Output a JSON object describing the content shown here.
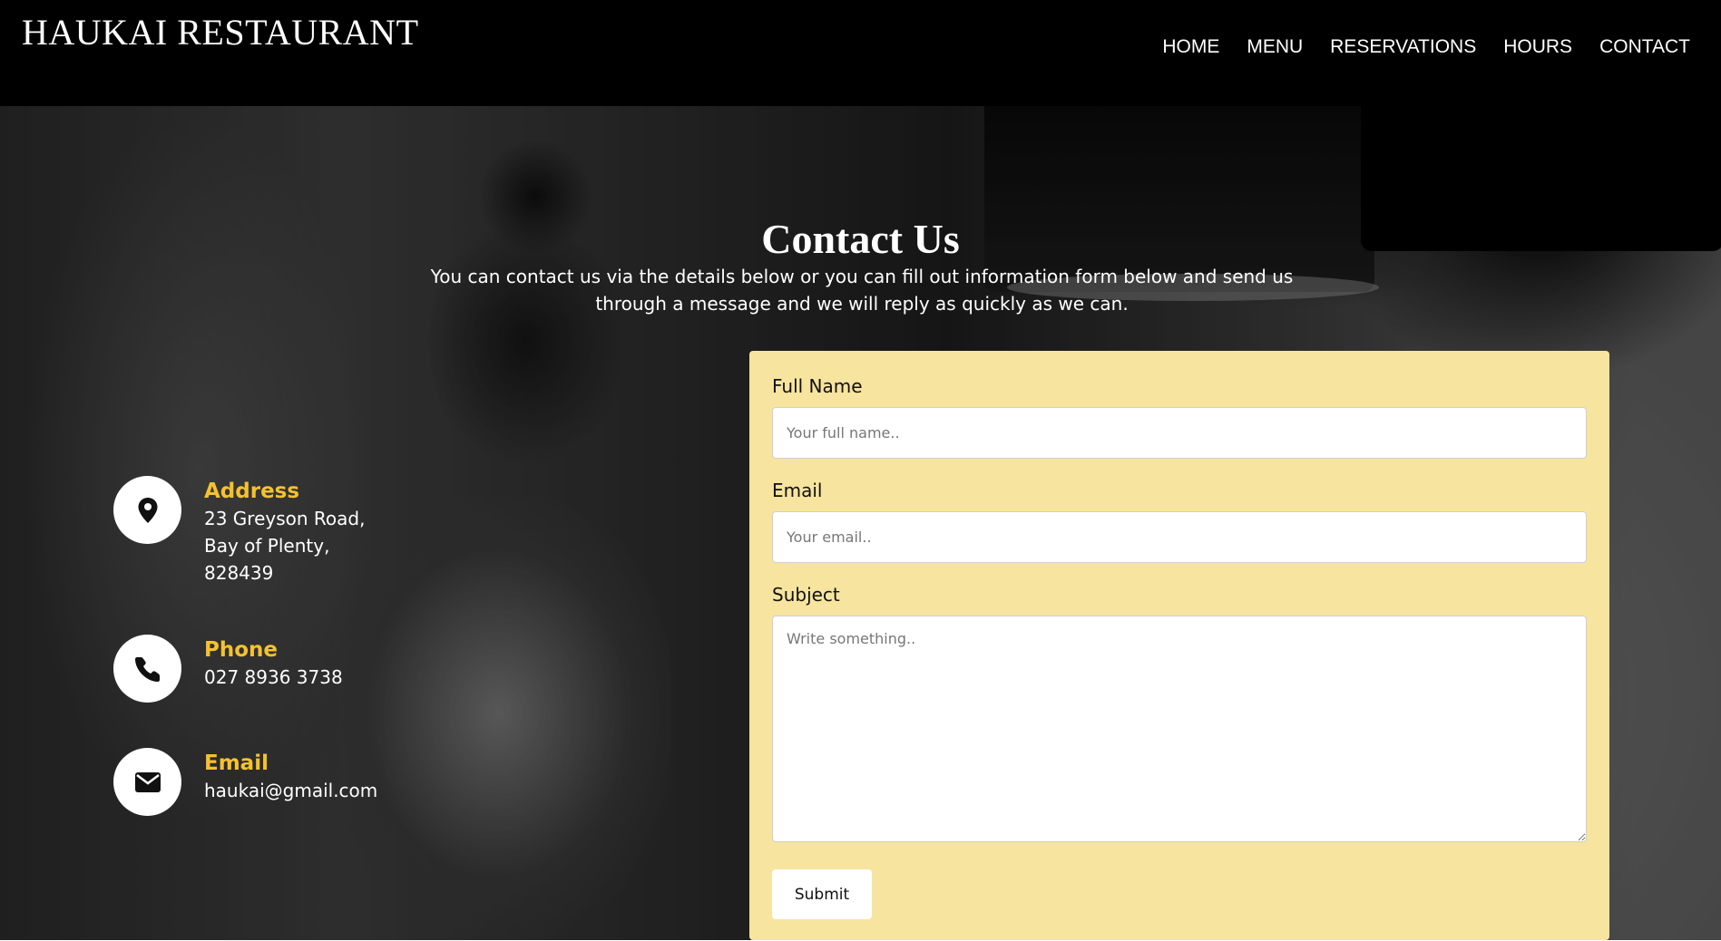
{
  "header": {
    "brand": "HAUKAI RESTAURANT",
    "nav": [
      "HOME",
      "MENU",
      "RESERVATIONS",
      "HOURS",
      "CONTACT"
    ]
  },
  "hero": {
    "title": "Contact Us",
    "subtitle": "You can contact us via the details below or you can fill out information form below and send us through a message and we will reply as quickly as we can."
  },
  "contact_info": {
    "address": {
      "heading": "Address",
      "lines": [
        "23 Greyson Road,",
        "Bay of Plenty,",
        "828439"
      ],
      "icon": "map-pin-icon"
    },
    "phone": {
      "heading": "Phone",
      "lines": [
        "027 8936 3738"
      ],
      "icon": "phone-icon"
    },
    "email": {
      "heading": "Email",
      "lines": [
        "haukai@gmail.com"
      ],
      "icon": "envelope-icon"
    }
  },
  "form": {
    "full_name": {
      "label": "Full Name",
      "placeholder": "Your full name.."
    },
    "email": {
      "label": "Email",
      "placeholder": "Your email.."
    },
    "subject": {
      "label": "Subject",
      "placeholder": "Write something.."
    },
    "submit_label": "Submit"
  },
  "colors": {
    "header_bg": "#000000",
    "accent_heading": "#f5c12e",
    "form_panel_bg": "#f7e49e",
    "text_light": "#ffffff"
  }
}
